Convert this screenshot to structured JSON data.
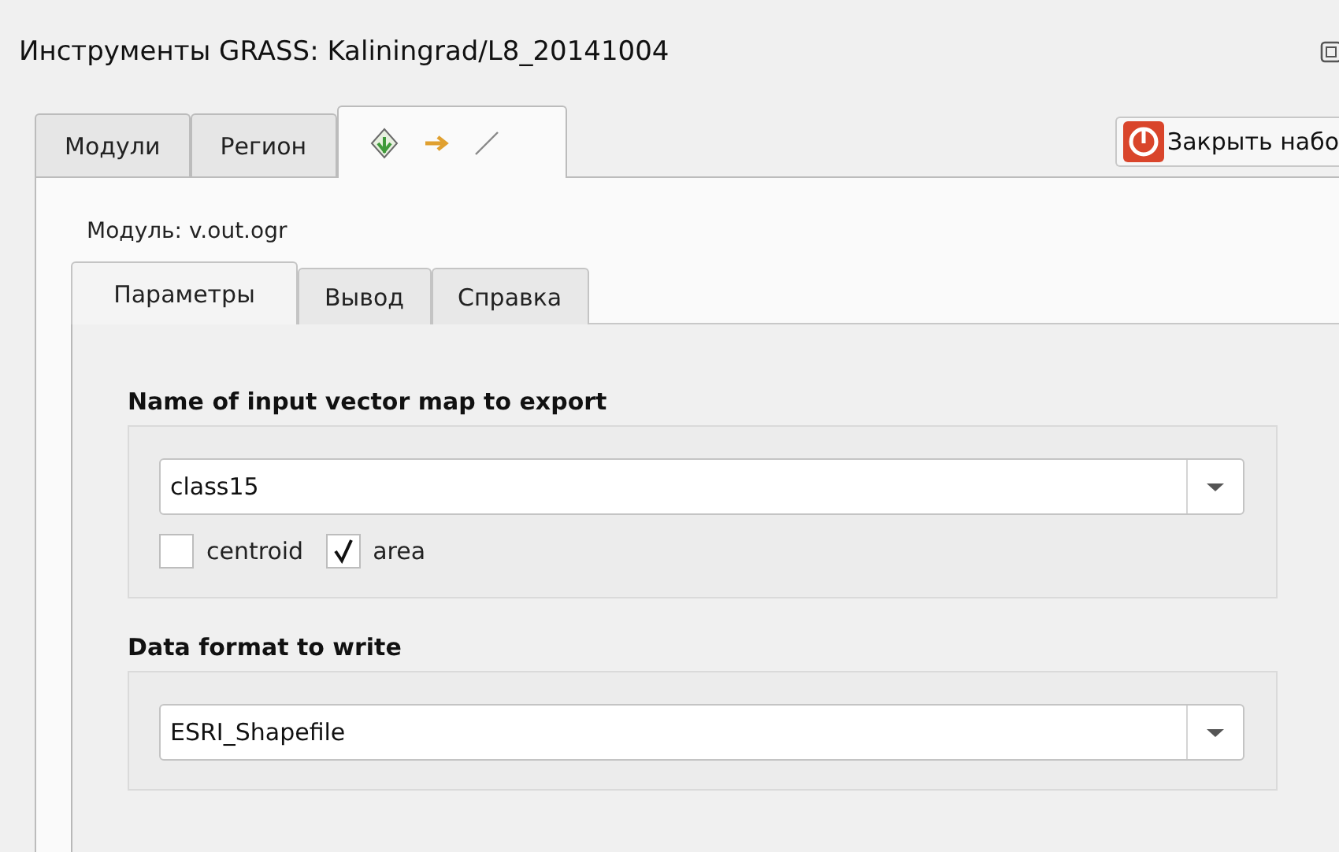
{
  "window": {
    "title": "Инструменты GRASS: Kaliningrad/L8_20141004"
  },
  "tabs": [
    {
      "kind": "text",
      "label": "Модули",
      "selected": false
    },
    {
      "kind": "text",
      "label": "Регион",
      "selected": false
    },
    {
      "kind": "icons",
      "selected": true
    }
  ],
  "close_button": {
    "label": "Закрыть набо"
  },
  "module": {
    "label": "Модуль: v.out.ogr"
  },
  "module_tabs": [
    {
      "label": "Параметры",
      "selected": true
    },
    {
      "label": "Вывод",
      "selected": false
    },
    {
      "label": "Справка",
      "selected": false
    }
  ],
  "parameters": [
    {
      "label": "Name of input vector map to export",
      "value": "class15",
      "options": [
        {
          "label": "centroid",
          "checked": false
        },
        {
          "label": "area",
          "checked": true
        }
      ]
    },
    {
      "label": "Data format to write",
      "value": "ESRI_Shapefile"
    }
  ]
}
